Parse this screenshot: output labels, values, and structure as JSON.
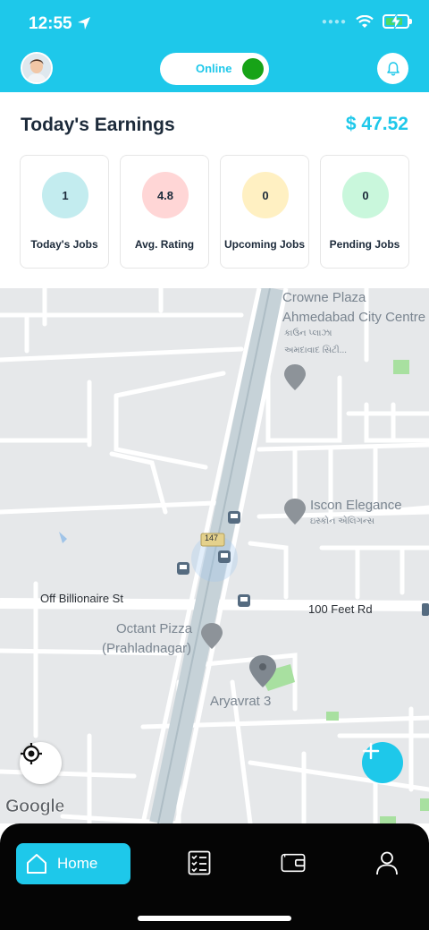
{
  "status": {
    "time": "12:55"
  },
  "header": {
    "online_label": "Online"
  },
  "earnings": {
    "title": "Today's Earnings",
    "amount": "$ 47.52",
    "stats": [
      {
        "value": "1",
        "label": "Today's Jobs",
        "color": "#c3ecef"
      },
      {
        "value": "4.8",
        "label": "Avg. Rating",
        "color": "#ffd6d6"
      },
      {
        "value": "0",
        "label": "Upcoming Jobs",
        "color": "#fff0c2"
      },
      {
        "value": "0",
        "label": "Pending Jobs",
        "color": "#c9f7dc"
      }
    ]
  },
  "map": {
    "places": {
      "crowne_line1": "Crowne Plaza",
      "crowne_line2": "Ahmedabad City Centre",
      "crowne_gu1": "કાઉન પ્લાઝા",
      "crowne_gu2": "અમદાવાદ સિટી...",
      "iscon": "Iscon Elegance",
      "iscon_gu": "ઇસ્કોન એલિગન્સ",
      "octant1": "Octant Pizza",
      "octant2": "(Prahladnagar)",
      "aryavrat": "Aryavrat 3"
    },
    "roads": {
      "billionaire": "Off Billionaire St",
      "feet": "100 Feet Rd",
      "shield": "147"
    },
    "attribution": "Google"
  },
  "nav": {
    "home_label": "Home"
  },
  "colors": {
    "accent": "#1ec8ea",
    "online_dot": "#17a317",
    "title_text": "#1c2a3a"
  }
}
